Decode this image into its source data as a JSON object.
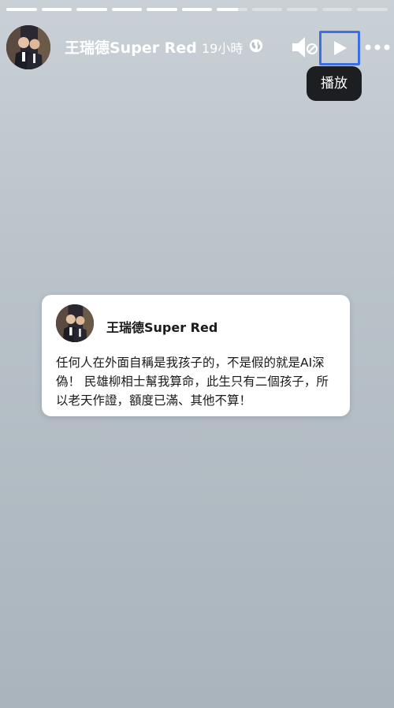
{
  "story": {
    "progress": [
      1,
      1,
      1,
      1,
      1,
      1,
      0.7,
      0,
      0,
      0,
      0
    ],
    "author": "王瑞德Super Red",
    "time": "19小時",
    "icons": {
      "globe": "globe-icon",
      "mute": "speaker-muted-icon",
      "play": "play-icon",
      "more": "more-horizontal-icon"
    },
    "play_tooltip": "播放"
  },
  "post_card": {
    "author": "王瑞德Super Red",
    "text": "任何人在外面自稱是我孩子的，不是假的就是AI深偽！ 民雄柳相士幫我算命，此生只有二個孩子，所以老天作證，額度已滿、其他不算！"
  },
  "colors": {
    "accent": "#3c6fe6",
    "tooltip_bg": "#1c1e21",
    "card_bg": "#ffffff"
  }
}
